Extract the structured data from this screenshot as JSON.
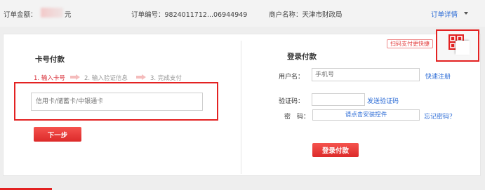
{
  "topbar": {
    "amount_label": "订单金额：",
    "amount_suffix": "元",
    "order_no": "订单编号：9824011712...06944949",
    "merchant": "商户名称：天津市财政局",
    "detail_link": "订单详情"
  },
  "card_pay": {
    "title": "卡号付款",
    "steps": [
      {
        "num": "1.",
        "label": "输入卡号"
      },
      {
        "num": "2.",
        "label": "输入验证信息"
      },
      {
        "num": "3.",
        "label": "完成支付"
      }
    ],
    "card_placeholder": "信用卡/储蓄卡/中银通卡",
    "next_button": "下一步"
  },
  "login_pay": {
    "title": "登录付款",
    "username_label": "用户名：",
    "username_placeholder": "手机号",
    "register_link": "快速注册",
    "captcha_label": "验证码：",
    "send_code_link": "发送验证码",
    "password_label": "密　码：",
    "plugin_text": "请点击安装控件",
    "forgot_link": "忘记密码？",
    "login_button": "登录付款"
  },
  "qr": {
    "tag": "扫码支付更快捷",
    "icon": "qr-code-icon"
  },
  "colors": {
    "accent": "#e32222",
    "link": "#2b6bd6"
  }
}
